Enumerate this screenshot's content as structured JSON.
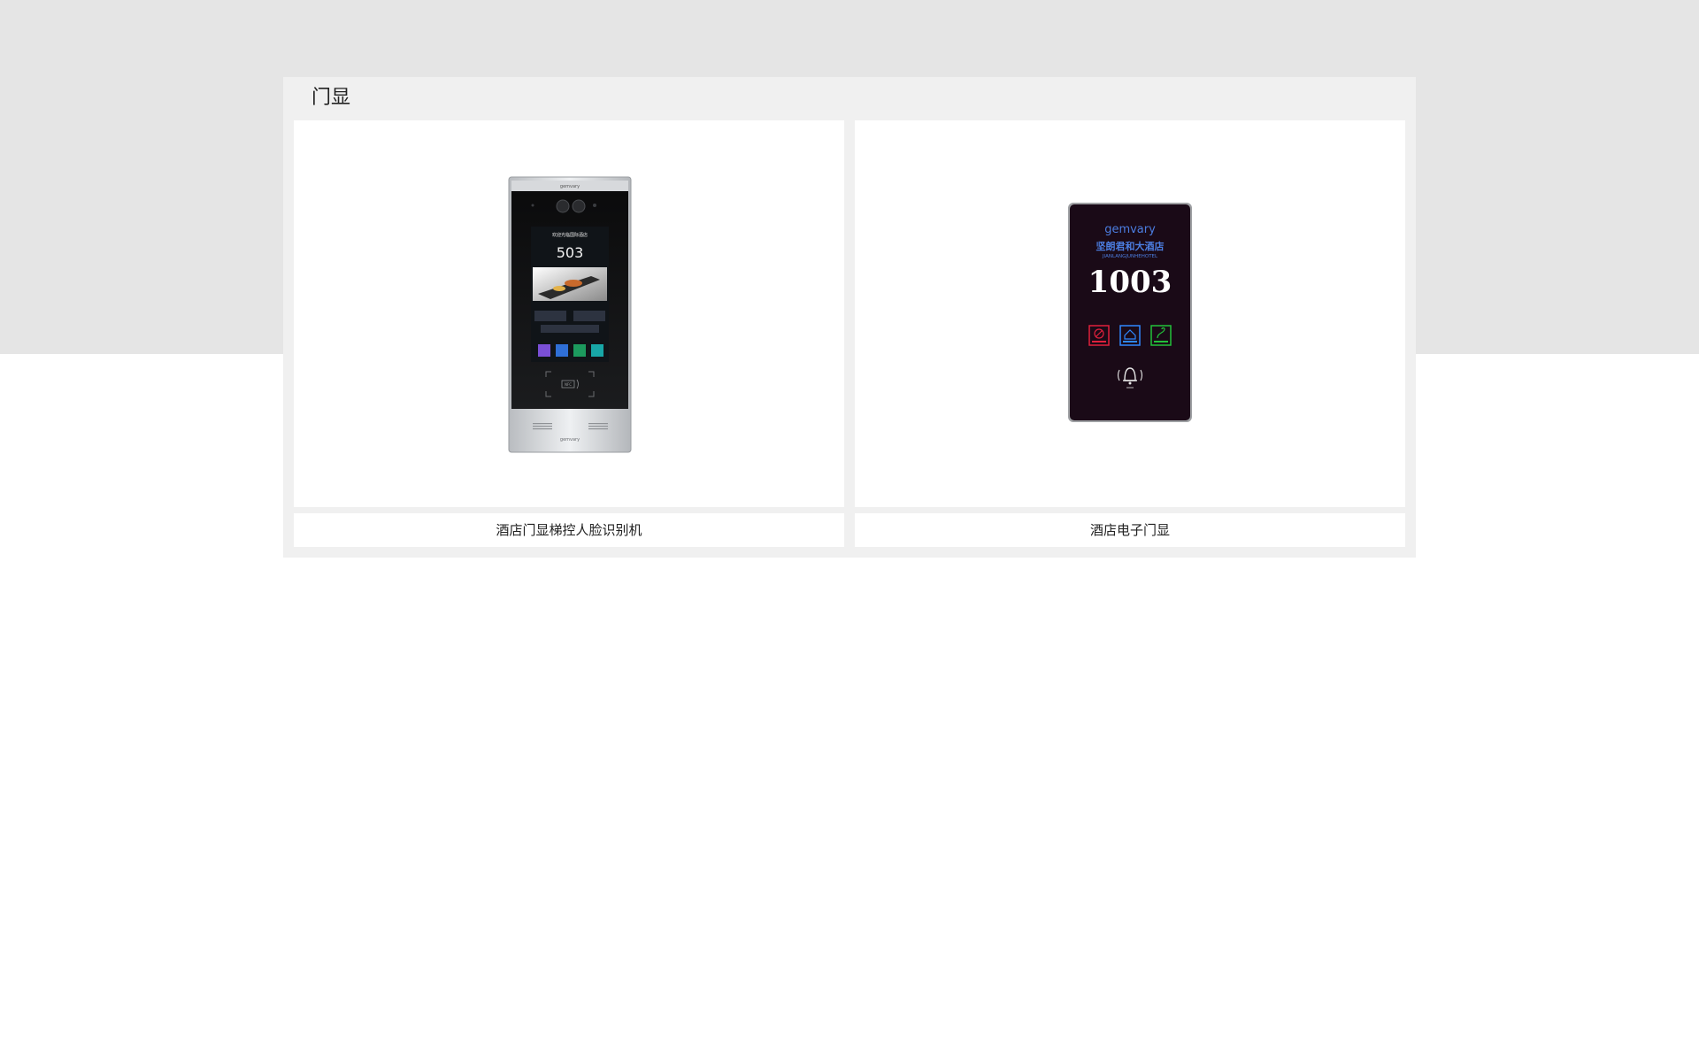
{
  "section": {
    "title": "门显"
  },
  "products": [
    {
      "name": "酒店门显梯控人脸识别机",
      "image": {
        "icon": "face-recognition-terminal-image",
        "welcome_text": "欢迎光临国际酒店",
        "room_number": "503",
        "brand": "gemvary",
        "nfc_label": "NFC"
      }
    },
    {
      "name": "酒店电子门显",
      "image": {
        "icon": "electronic-door-plate-image",
        "brand": "gemvary",
        "hotel_name": "坚朗君和大酒店",
        "hotel_name_en": "JIANLANGJUNHEHOTEL",
        "room_number": "1003",
        "status_icons": [
          {
            "icon": "do-not-disturb-icon",
            "color": "#e0203c"
          },
          {
            "icon": "please-clean-icon",
            "color": "#2f88ff"
          },
          {
            "icon": "laundry-service-icon",
            "color": "#22c13a"
          }
        ],
        "doorbell_icon": "doorbell-icon"
      }
    }
  ],
  "colors": {
    "top_band": "#e5e5e5",
    "panel": "#f0f0f0",
    "card": "#ffffff",
    "text": "#222222"
  }
}
